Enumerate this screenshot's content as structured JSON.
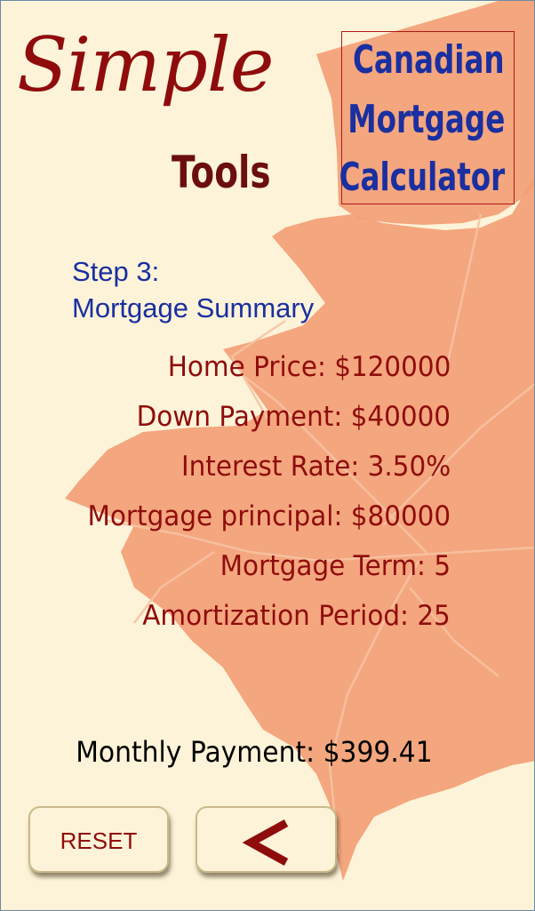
{
  "brand": {
    "word1": "Simple",
    "word2": "Tools"
  },
  "app_title": {
    "line1": "Canadian",
    "line2": "Mortgage",
    "line3": "Calculator"
  },
  "step": {
    "label": "Step 3:",
    "title": "Mortgage Summary"
  },
  "summary": {
    "home_price": "Home Price: $120000",
    "down_payment": "Down Payment: $40000",
    "interest_rate": "Interest Rate: 3.50%",
    "mortgage_principal": "Mortgage principal: $80000",
    "mortgage_term": "Mortgage Term: 5",
    "amortization_period": "Amortization Period: 25"
  },
  "result": {
    "monthly_payment": "Monthly Payment: $399.41"
  },
  "buttons": {
    "reset_label": "RESET",
    "back_icon": "chevron-left-icon"
  },
  "colors": {
    "background": "#fdf3d8",
    "brand_red": "#8f0c0c",
    "title_blue": "#1a2fa0",
    "leaf_orange": "#f29a6e"
  }
}
